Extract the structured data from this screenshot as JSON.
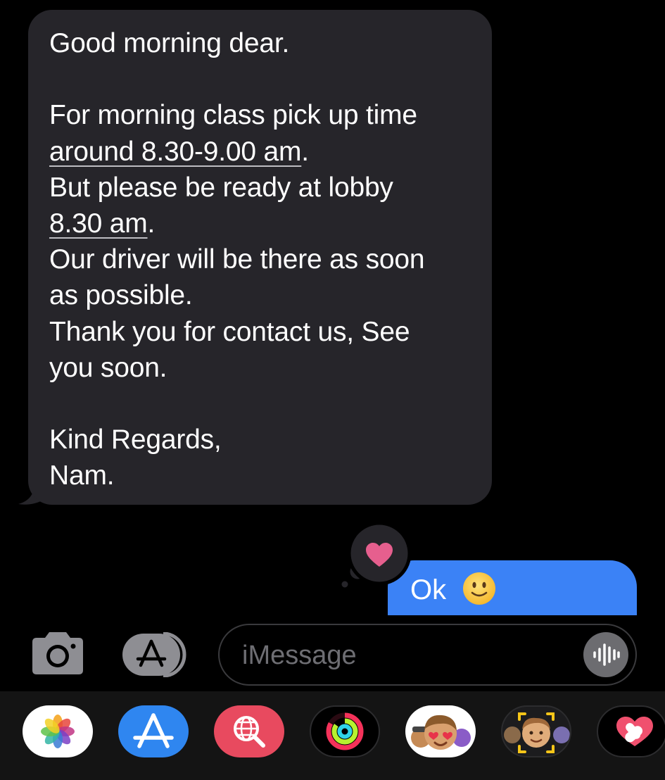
{
  "conversation": {
    "incoming_message": {
      "lines": [
        "Good morning dear.",
        "",
        "For morning class pick up time",
        "around 8.30-9.00 am.",
        "But please be ready at lobby",
        "8.30 am.",
        "Our driver will be there as soon",
        "as possible.",
        "Thank you for contact us, See",
        "you soon.",
        "",
        "Kind Regards,",
        "Nam."
      ],
      "link_1": "around 8.30-9.00 am",
      "link_1_suffix": ".",
      "link_2": "8.30 am",
      "link_2_suffix": "."
    },
    "outgoing_message": {
      "text": "Ok",
      "emoji": "slightly-smiling-face-emoji"
    },
    "tapback": {
      "icon": "heart-icon",
      "color": "#e65f8e"
    }
  },
  "input_bar": {
    "camera_icon": "camera-icon",
    "apps_icon": "app-store-icon",
    "message_placeholder": "iMessage",
    "audio_icon": "waveform-icon"
  },
  "app_drawer": {
    "apps": [
      {
        "name": "Photos",
        "icon": "photos-icon"
      },
      {
        "name": "App Store",
        "icon": "app-store-icon"
      },
      {
        "name": "Images",
        "icon": "image-search-icon"
      },
      {
        "name": "Activity",
        "icon": "activity-rings-icon"
      },
      {
        "name": "Memoji Stickers",
        "icon": "memoji-stickers-icon"
      },
      {
        "name": "Memoji",
        "icon": "memoji-icon"
      },
      {
        "name": "Digital Touch",
        "icon": "digital-touch-icon"
      }
    ]
  },
  "colors": {
    "background": "#000000",
    "incoming_bubble": "#26252a",
    "outgoing_bubble": "#3b82f6",
    "accent_pink": "#e65f8e"
  }
}
